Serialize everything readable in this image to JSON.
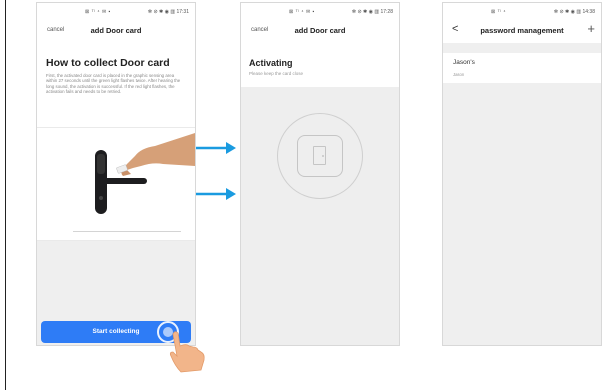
{
  "screen1": {
    "status_signal": "⊠ ᵀˡ ⁴ ✉ ▪",
    "status_right": "✻ ⊘ ✱ ◉ ▥ 17:31",
    "cancel": "cancel",
    "title": "add Door card",
    "heading": "How to collect Door card",
    "description": "First, the activated door card is placed in the graphic sensing area within 27 seconds until the green light flashes twice. After hearing the long sound, the activation is successful. If the red light flashes, the activation fails and needs to be retried.",
    "start_button": "Start collecting"
  },
  "screen2": {
    "status_signal": "⊠ ᵀˡ ⁴ ✉ ▪",
    "status_right": "✻ ⊘ ✱ ◉ ▥ 17:28",
    "cancel": "cancel",
    "title": "add Door card",
    "heading": "Activating",
    "subtext": "Please keep the card close"
  },
  "screen3": {
    "status_signal": "⊠ ᵀˡ ⁴",
    "status_right": "✻ ⊘ ✱ ◉ ▥ 14:38",
    "back": "<",
    "title": "password management",
    "add": "+",
    "entry_name": "Jason's",
    "entry_owner": "Jason"
  },
  "colors": {
    "accent": "#2e7cf6",
    "arrow": "#1a9be0"
  },
  "icons": [
    "door-icon",
    "tap-hand-icon",
    "arrow-right-icon",
    "back-arrow-icon",
    "plus-icon"
  ]
}
